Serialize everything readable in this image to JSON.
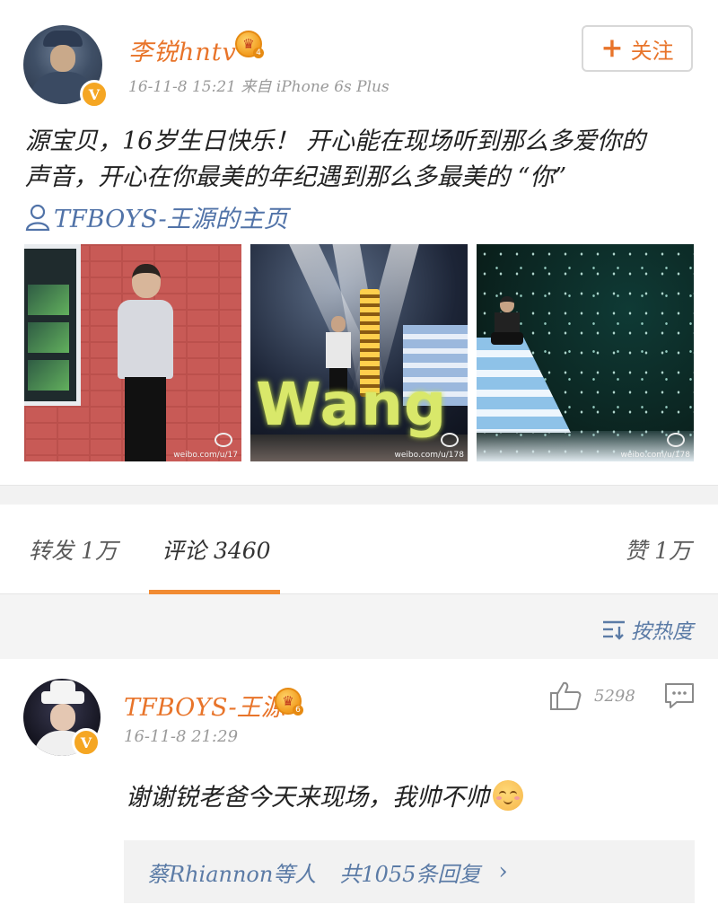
{
  "post": {
    "author": "李锐hntv",
    "crown_level": "4",
    "verified_mark": "V",
    "meta": "16-11-8 15:21  来自 iPhone 6s Plus",
    "follow_label": "关注",
    "text_line1": "源宝贝，16岁生日快乐！ 开心能在现场听到那么多爱你的",
    "text_line2": "声音，开心在你最美的年纪遇到那么多最美的 “你”",
    "topic": "TFBOYS-王源的主页",
    "photos": [
      {
        "watermark": "weibo.com/u/17"
      },
      {
        "sign_text": "Wang",
        "watermark": "weibo.com/u/178"
      },
      {
        "watermark": "weibo.com/u/178"
      }
    ]
  },
  "tabs": {
    "repost": "转发 1万",
    "comment": "评论 3460",
    "like": "赞 1万",
    "accent": "#f18b32"
  },
  "sort": {
    "label": "按热度"
  },
  "comment": {
    "author": "TFBOYS-王源",
    "crown_level": "6",
    "verified_mark": "V",
    "time": "16-11-8 21:29",
    "likes": "5298",
    "text": "谢谢锐老爸今天来现场，我帅不帅",
    "replies_who": "蔡Rhiannon等人",
    "replies_count": "共1055条回复",
    "replies_chevron": "›"
  },
  "colors": {
    "username": "#e8742a",
    "link": "#5b7ba6",
    "verified": "#f5a623"
  }
}
